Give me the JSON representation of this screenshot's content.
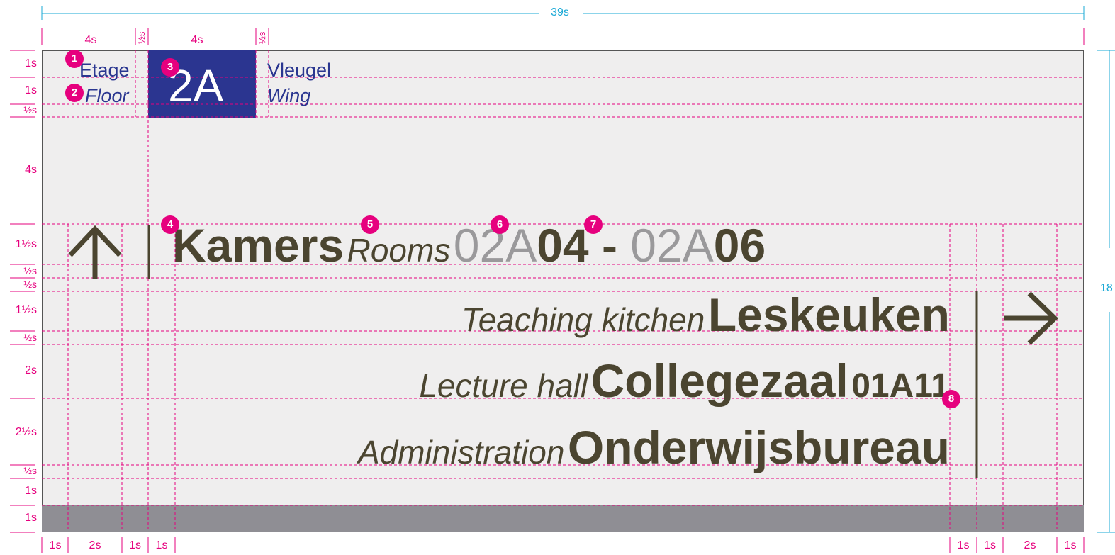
{
  "overall_width": "39s",
  "overall_height_partial": "18",
  "top_dimensions": [
    "4s",
    "½s",
    "4s",
    "½s"
  ],
  "left_dimensions": [
    "1s",
    "1s",
    "½s",
    "4s",
    "1½s",
    "½s",
    "½s",
    "1½s",
    "½s",
    "2s",
    "2½s",
    "½s",
    "1s",
    "1s"
  ],
  "bottom_left_dimensions": [
    "1s",
    "2s",
    "1s",
    "1s"
  ],
  "bottom_right_dimensions": [
    "1s",
    "1s",
    "2s",
    "1s"
  ],
  "header": {
    "floor_label_nl": "Etage",
    "floor_label_en": "Floor",
    "floor_value": "2A",
    "wing_label_nl": "Vleugel",
    "wing_label_en": "Wing"
  },
  "direction_up": {
    "arrow": "up-arrow-icon",
    "title_nl": "Kamers",
    "title_en": "Rooms",
    "range_start_prefix": "02A",
    "range_start_number": "04",
    "range_separator": " - ",
    "range_end_prefix": "02A",
    "range_end_number": "06"
  },
  "direction_right": {
    "arrow": "right-arrow-icon",
    "items": [
      {
        "en": "Teaching kitchen",
        "nl": "Leskeuken",
        "number": ""
      },
      {
        "en": "Lecture hall",
        "nl": "Collegezaal",
        "number": "01A11"
      },
      {
        "en": "Administration",
        "nl": "Onderwijsbureau",
        "number": ""
      }
    ]
  },
  "badges": [
    "1",
    "2",
    "3",
    "4",
    "5",
    "6",
    "7",
    "8"
  ],
  "colors": {
    "accent_magenta": "#e6007e",
    "dimension_cyan": "#1aa9d6",
    "navy": "#2b3590",
    "olive_text": "#4b4530",
    "panel": "#efeeee",
    "footer": "#8f8e94"
  }
}
